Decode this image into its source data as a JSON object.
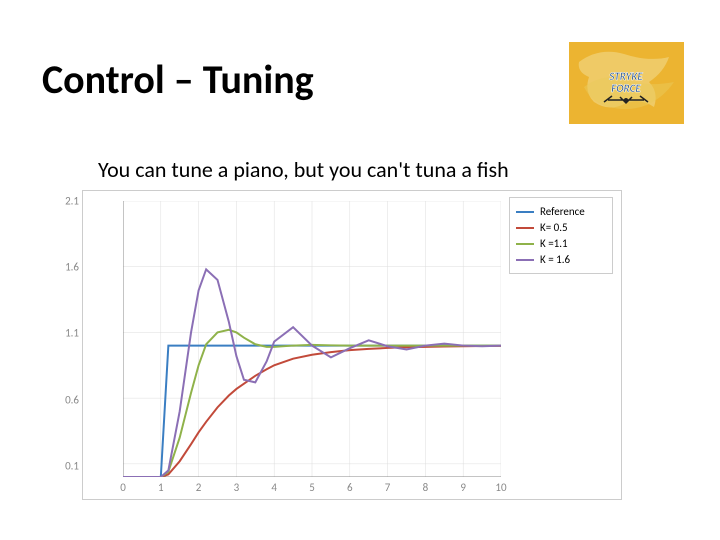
{
  "title": "Control – Tuning",
  "subtitle": "You can tune a piano, but you can't tuna a fish",
  "logo": {
    "name": "Stryke Force"
  },
  "chart_data": {
    "type": "line",
    "title": "",
    "xlabel": "",
    "ylabel": "",
    "xlim": [
      0,
      10
    ],
    "ylim": [
      0,
      2.1
    ],
    "y_ticks": [
      0.1,
      0.6,
      1.1,
      1.6,
      2.1
    ],
    "x_ticks": [
      0,
      1,
      2,
      3,
      4,
      5,
      6,
      7,
      8,
      9,
      10
    ],
    "x": [
      0,
      0.5,
      1,
      1.2,
      1.5,
      1.8,
      2,
      2.2,
      2.5,
      2.8,
      3,
      3.2,
      3.5,
      3.8,
      4,
      4.5,
      5,
      5.5,
      6,
      6.5,
      7,
      7.5,
      8,
      8.5,
      9,
      9.5,
      10
    ],
    "series": [
      {
        "name": "Reference",
        "color": "#3a7ec2",
        "values": [
          0,
          0,
          0,
          1,
          1,
          1,
          1,
          1,
          1,
          1,
          1,
          1,
          1,
          1,
          1,
          1,
          1,
          1,
          1,
          1,
          1,
          1,
          1,
          1,
          1,
          1,
          1
        ]
      },
      {
        "name": "K= 0.5",
        "color": "#c24a3a",
        "values": [
          0,
          0,
          0,
          0.02,
          0.12,
          0.25,
          0.34,
          0.42,
          0.53,
          0.62,
          0.67,
          0.71,
          0.77,
          0.82,
          0.85,
          0.9,
          0.93,
          0.95,
          0.965,
          0.975,
          0.982,
          0.987,
          0.99,
          0.993,
          0.995,
          0.997,
          0.998
        ]
      },
      {
        "name": "K =1.1",
        "color": "#8fb24a",
        "values": [
          0,
          0,
          0,
          0.04,
          0.3,
          0.64,
          0.85,
          1.01,
          1.1,
          1.12,
          1.1,
          1.06,
          1.01,
          0.99,
          0.99,
          1.0,
          1.005,
          1.002,
          1.0,
          1.0,
          1.0,
          1.0,
          1.0,
          1.0,
          1.0,
          1.0,
          1.0
        ]
      },
      {
        "name": "K = 1.6",
        "color": "#8b6fb5",
        "values": [
          0,
          0,
          0,
          0.05,
          0.5,
          1.1,
          1.42,
          1.58,
          1.5,
          1.18,
          0.92,
          0.74,
          0.72,
          0.88,
          1.03,
          1.14,
          1.0,
          0.91,
          0.98,
          1.04,
          0.995,
          0.97,
          1.0,
          1.015,
          1.0,
          0.995,
          1.0
        ]
      }
    ]
  },
  "legend": {
    "entries": [
      "Reference",
      "K= 0.5",
      "K =1.1",
      "K = 1.6"
    ]
  }
}
